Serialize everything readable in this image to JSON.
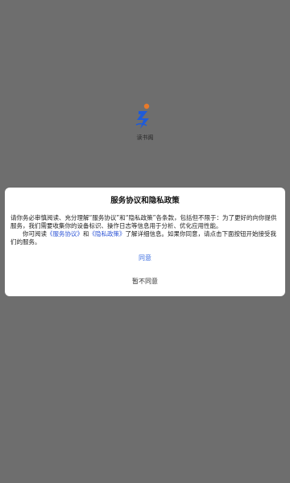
{
  "app": {
    "name": "读书阁",
    "logo_icon": "reader-logo-icon",
    "logo_colors": {
      "blue": "#1f5bd8",
      "orange": "#e87a2a"
    }
  },
  "dialog": {
    "title": "服务协议和隐私政策",
    "para1": "请你务必审慎阅读、充分理解“服务协议”和“隐私政策”各条款，包括但不限于：为了更好的向你提供服务，我们需要收集你的设备标识、操作日志等信息用于分析、优化应用性能。",
    "para2_prefix": "你可阅读",
    "service_link": "《服务协议》",
    "para2_and": "和",
    "privacy_link": "《隐私政策》",
    "para2_suffix": "了解详细信息。如果你同意，请点击下面按钮开始接受我们的服务。",
    "agree_label": "同意",
    "disagree_label": "暂不同意"
  }
}
